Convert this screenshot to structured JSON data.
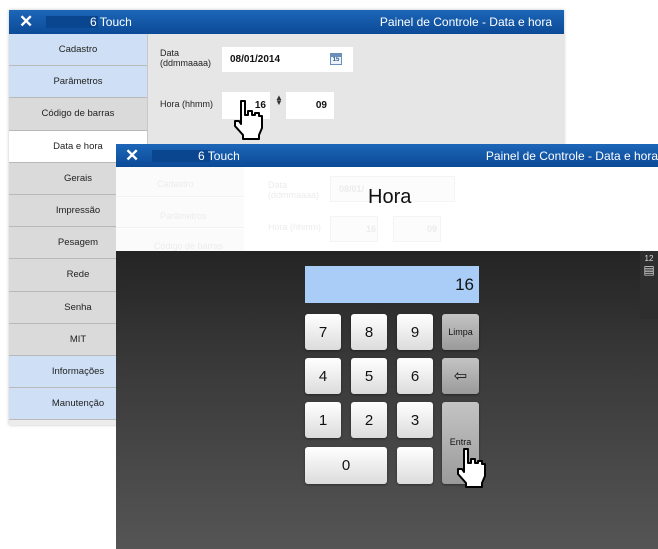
{
  "back_window": {
    "close_glyph": "✕",
    "app_name": "6 Touch",
    "page_title": "Painel de Controle - Data e hora",
    "sidebar": [
      {
        "label": "Cadastro",
        "style": "blue"
      },
      {
        "label": "Parâmetros",
        "style": "blue"
      },
      {
        "label": "Código de barras",
        "style": "gray"
      },
      {
        "label": "Data e hora",
        "style": "white"
      },
      {
        "label": "Gerais",
        "style": "gray"
      },
      {
        "label": "Impressão",
        "style": "gray"
      },
      {
        "label": "Pesagem",
        "style": "gray"
      },
      {
        "label": "Rede",
        "style": "gray"
      },
      {
        "label": "Senha",
        "style": "gray"
      },
      {
        "label": "MIT",
        "style": "gray"
      },
      {
        "label": "Informações",
        "style": "blue"
      },
      {
        "label": "Manutenção",
        "style": "blue"
      }
    ],
    "date_label_line1": "Data",
    "date_label_line2": "(ddmmaaaa)",
    "date_value": "08/01/2014",
    "calendar_day": "15",
    "time_label": "Hora (hhmm)",
    "hour_value": "16",
    "minute_value": "09",
    "spin_up": "▲",
    "spin_down": "▼"
  },
  "front_window": {
    "close_glyph": "✕",
    "app_name": "6 Touch",
    "page_title": "Painel de Controle - Data e hora",
    "dialog_title": "Hora",
    "ghost": {
      "sidebar": [
        "Cadastro",
        "Parâmetros",
        "Código de barras"
      ],
      "date_label_line1": "Data",
      "date_label_line2": "(ddmmaaaa)",
      "date_value": "08/01/",
      "time_label": "Hora (hhmm)",
      "hour_value": "16",
      "minute_value": "09"
    },
    "keypad": {
      "display_value": "16",
      "digits": [
        "7",
        "8",
        "9",
        "4",
        "5",
        "6",
        "1",
        "2",
        "3",
        "0"
      ],
      "clear_label": "Limpa",
      "backspace_glyph": "⇦",
      "enter_label": "Entra"
    },
    "edge_text": "12",
    "edge_glyph": "▤"
  },
  "colors": {
    "titlebar": "#0b4a97",
    "sidebar_blue": "#cfe0f6",
    "display": "#a9cdf7"
  }
}
